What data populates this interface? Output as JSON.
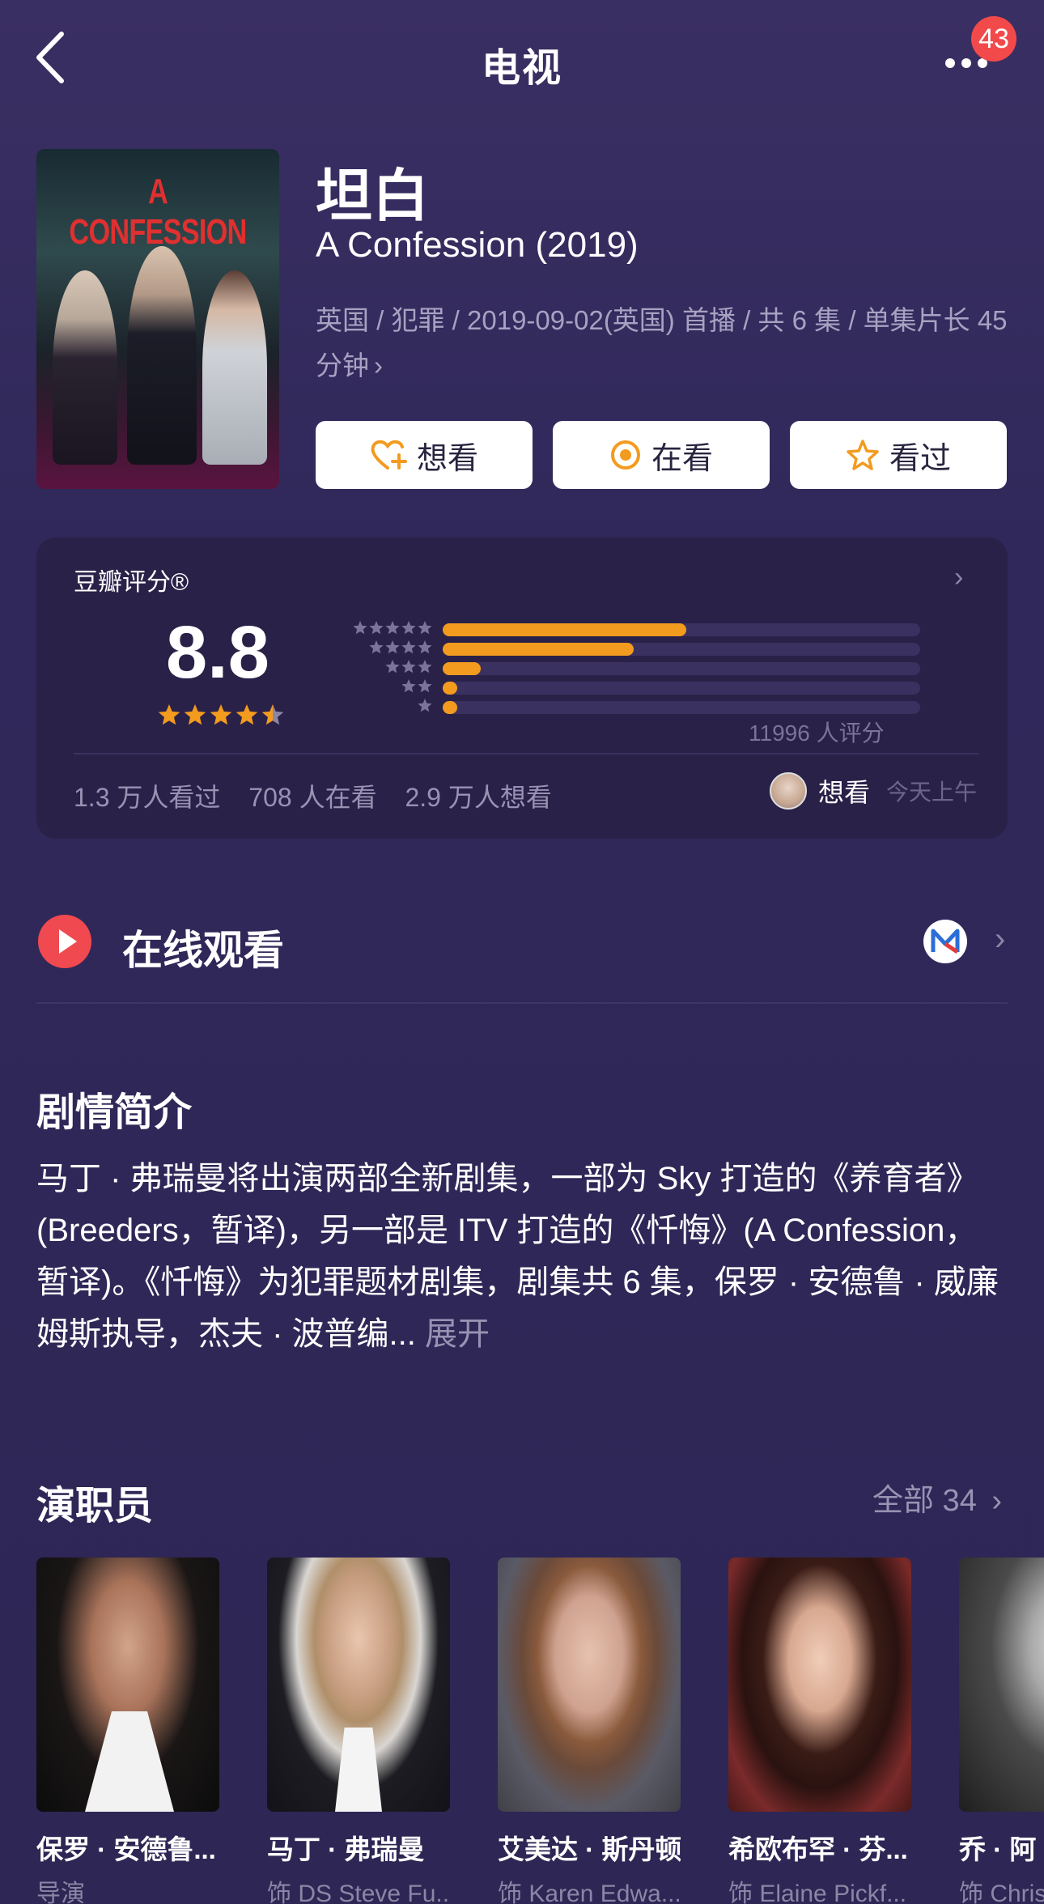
{
  "header": {
    "title": "电视",
    "badge_count": "43"
  },
  "show": {
    "title_cn": "坦白",
    "title_en": "A Confession (2019)",
    "poster_text": "A CONFESSION",
    "meta": "英国 / 犯罪 / 2019-09-02(英国) 首播 / 共 6 集 / 单集片长 45 分钟",
    "meta_chevron": "›"
  },
  "actions": {
    "want": "想看",
    "watching": "在看",
    "watched": "看过"
  },
  "rating": {
    "label": "豆瓣评分®",
    "score": "8.8",
    "stars": 4.5,
    "distribution": [
      0.51,
      0.4,
      0.08,
      0.03,
      0.03
    ],
    "count_text": "11996 人评分",
    "watched": "1.3 万人看过",
    "watching": "708 人在看",
    "want": "2.9 万人想看",
    "friend_action": "想看",
    "friend_time": "今天上午"
  },
  "online": {
    "label": "在线观看"
  },
  "synopsis": {
    "title": "剧情简介",
    "text": "马丁 · 弗瑞曼将出演两部全新剧集，一部为 Sky 打造的《养育者》(Breeders，暂译)，另一部是 ITV 打造的《忏悔》(A Confession，暂译)。《忏悔》为犯罪题材剧集，剧集共 6 集，保罗 · 安德鲁 · 威廉姆斯执导，杰夫 · 波普编...",
    "expand": "展开"
  },
  "cast": {
    "title": "演职员",
    "see_all": "全部 34",
    "members": [
      {
        "name": "保罗 · 安德鲁...",
        "role": "导演"
      },
      {
        "name": "马丁 · 弗瑞曼",
        "role": "饰 DS Steve Fu..."
      },
      {
        "name": "艾美达 · 斯丹顿",
        "role": "饰 Karen Edwa..."
      },
      {
        "name": "希欧布罕 · 芬...",
        "role": "饰 Elaine Pickf..."
      },
      {
        "name": "乔 · 阿",
        "role": "饰 Chris"
      }
    ]
  },
  "colors": {
    "background": "#2f2651",
    "card": "#2a2148",
    "accent_orange": "#f39b1f",
    "badge_red": "#f24a4a",
    "muted_text": "#9892b3"
  }
}
